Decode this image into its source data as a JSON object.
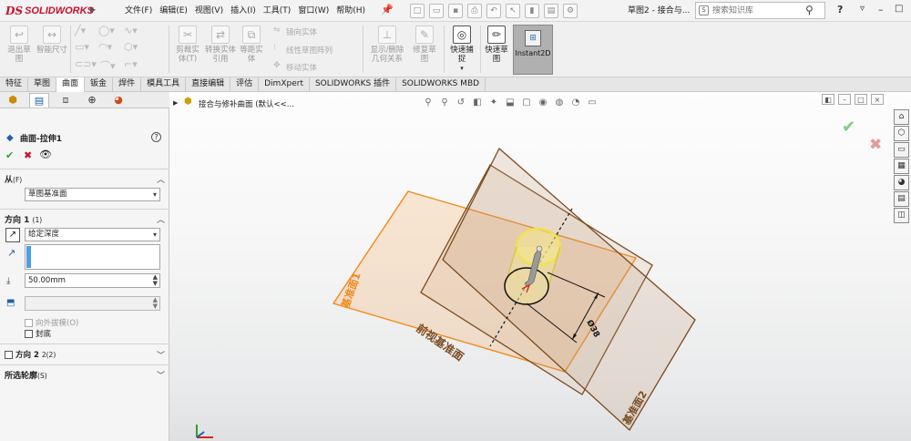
{
  "app": {
    "logo_ds": "DS",
    "logo_name": "SOLIDWORKS",
    "menus": [
      "文件(F)",
      "编辑(E)",
      "视图(V)",
      "插入(I)",
      "工具(T)",
      "窗口(W)",
      "帮助(H)"
    ],
    "document_title": "草图2 - 接合与...",
    "search_placeholder": "搜索知识库"
  },
  "ribbon": {
    "exit_sketch": "退出草图",
    "smart_dimension": "智能尺寸",
    "trim_entities": "剪裁实体(T)",
    "convert_entities": "转换实体引用",
    "offset_entities": "等距实体",
    "mirror_entities": "镜向实体",
    "linear_sketch_pattern": "线性草图阵列",
    "move_entities": "移动实体",
    "display_delete_relations": "显示/删除几何关系",
    "repair_sketch": "修复草图",
    "quick_snaps": "快速捕捉",
    "rapid_sketch": "快速草图",
    "instant2d": "Instant2D"
  },
  "tabs": [
    "特征",
    "草图",
    "曲面",
    "钣金",
    "焊件",
    "模具工具",
    "直接编辑",
    "评估",
    "DimXpert",
    "SOLIDWORKS 插件",
    "SOLIDWORKS MBD"
  ],
  "active_tab_index": 2,
  "property_manager": {
    "title": "曲面-拉伸1",
    "from_header": "从",
    "from_sub": "(F)",
    "from_value": "草图基准面",
    "dir1_header": "方向 1",
    "dir1_sub": "(1)",
    "end_condition": "给定深度",
    "depth": "50.00mm",
    "draft_outward": "向外拔模(O)",
    "cap_end": "封底",
    "dir2_header": "方向 2",
    "dir2_sub": "2(2)",
    "contours_header": "所选轮廓",
    "contours_sub": "(S)"
  },
  "graphics": {
    "tree_label": "接合与修补曲面 (默认<<...",
    "plane_front": "前视基准面",
    "plane1": "基准面1",
    "plane2": "基准面2",
    "dimension": "Ø38"
  },
  "colors": {
    "brand": "#c8102e",
    "plane_orange": "#f08a1c",
    "plane_brown": "#7a4a1e",
    "cylinder_yellow": "#f2e24a",
    "ok_green": "#2e9e35"
  }
}
